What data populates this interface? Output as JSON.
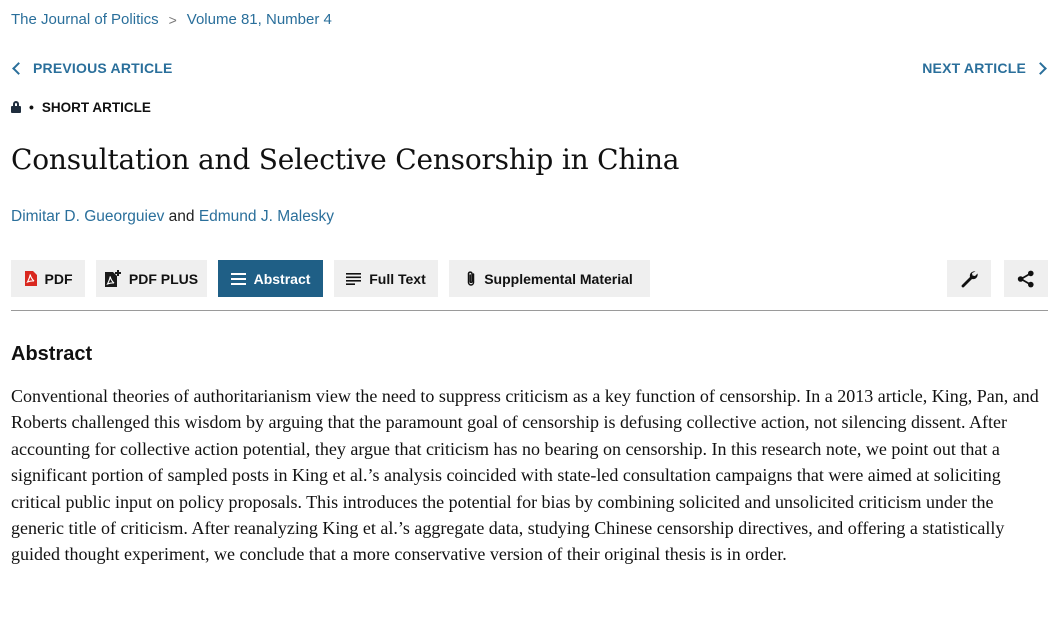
{
  "breadcrumb": {
    "journal": "The Journal of Politics",
    "separator": ">",
    "issue": "Volume 81, Number 4"
  },
  "nav": {
    "previous": "PREVIOUS ARTICLE",
    "next": "NEXT ARTICLE"
  },
  "article": {
    "type_dot": "•",
    "type": "SHORT ARTICLE",
    "title": "Consultation and Selective Censorship in China",
    "author1": "Dimitar D. Gueorguiev",
    "author_conj": " and ",
    "author2": "Edmund J. Malesky"
  },
  "toolbar": {
    "pdf": "PDF",
    "pdf_plus": "PDF PLUS",
    "abstract": "Abstract",
    "full_text": "Full Text",
    "supplemental": "Supplemental Material",
    "active_tab": "Abstract"
  },
  "icons": {
    "pdf": "pdf-icon",
    "pdf_plus": "pdf-plus-icon",
    "abstract": "list-icon",
    "full_text": "text-lines-icon",
    "supplemental": "paperclip-icon",
    "tools": "wrench-icon",
    "share": "share-icon",
    "access": "lock-icon"
  },
  "colors": {
    "link": "#2a6f9b",
    "active_tab_bg": "#1f5f86",
    "button_bg": "#efefef",
    "pdf_red": "#d9281f"
  },
  "abstract": {
    "heading": "Abstract",
    "text": "Conventional theories of authoritarianism view the need to suppress criticism as a key function of censorship. In a 2013 article, King, Pan, and Roberts challenged this wisdom by arguing that the paramount goal of censorship is defusing collective action, not silencing dissent. After accounting for collective action potential, they argue that criticism has no bearing on censorship. In this research note, we point out that a significant portion of sampled posts in King et al.’s analysis coincided with state-led consultation campaigns that were aimed at soliciting critical public input on policy proposals. This introduces the potential for bias by combining solicited and unsolicited criticism under the generic title of criticism. After reanalyzing King et al.’s aggregate data, studying Chinese censorship directives, and offering a statistically guided thought experiment, we conclude that a more conservative version of their original thesis is in order."
  }
}
